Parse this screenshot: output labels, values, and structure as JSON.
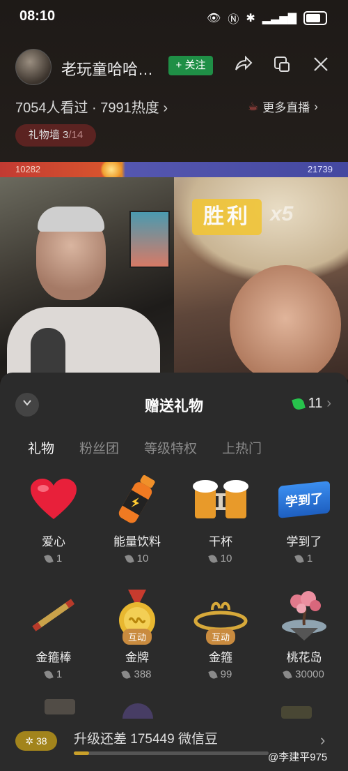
{
  "status": {
    "time": "08:10"
  },
  "header": {
    "host_name": "老玩童哈哈…",
    "follow_label": "+ 关注",
    "stats": "7054人看过 · 7991热度",
    "more_live": "更多直播",
    "gift_wall": "礼物墙",
    "gift_wall_count": "3",
    "gift_wall_total": "/14"
  },
  "pk": {
    "left_score": "10282",
    "right_score": "21739",
    "left_fraction": 0.33,
    "win_label": "胜利",
    "win_multiplier": "x5"
  },
  "panel": {
    "title": "赠送礼物",
    "coins": "11",
    "tabs": [
      "礼物",
      "粉丝团",
      "等级特权",
      "上热门"
    ],
    "gifts": [
      {
        "name": "爱心",
        "price": "1",
        "icon": "heart-icon"
      },
      {
        "name": "能量饮料",
        "price": "10",
        "icon": "energy-drink-icon"
      },
      {
        "name": "干杯",
        "price": "10",
        "icon": "beer-cheers-icon"
      },
      {
        "name": "学到了",
        "price": "1",
        "icon": "book-icon",
        "icon_text": "学到了"
      },
      {
        "name": "金箍棒",
        "price": "1",
        "icon": "golden-staff-icon"
      },
      {
        "name": "金牌",
        "price": "388",
        "icon": "gold-medal-icon",
        "badge": "互动"
      },
      {
        "name": "金箍",
        "price": "99",
        "icon": "golden-headband-icon",
        "badge": "互动"
      },
      {
        "name": "桃花岛",
        "price": "30000",
        "icon": "peach-island-icon"
      }
    ]
  },
  "level": {
    "badge": "38",
    "text": "升级还差 175449 微信豆",
    "progress": 0.08
  },
  "watermark": "@李建平975",
  "colors": {
    "follow": "#1f8f46",
    "coin_leaf": "#27c24c",
    "pk_left": "#c23a32",
    "pk_right": "#4448a0",
    "level_badge": "#a2841c"
  }
}
